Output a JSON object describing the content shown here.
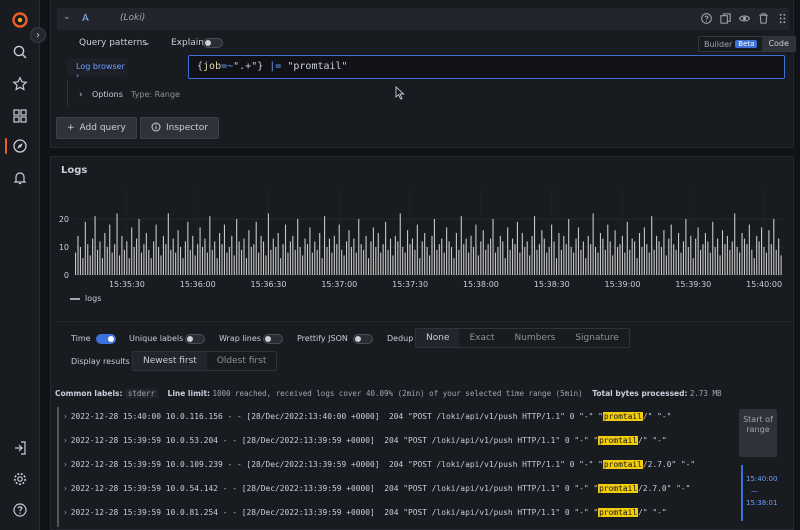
{
  "colors": {
    "accent": "#3d71d9",
    "brand": "#f05a28",
    "highlight": "#f2cc0c",
    "bars": "#c7c7c7"
  },
  "rail": {
    "icons": [
      "grafana-logo-icon",
      "search-icon",
      "star-icon",
      "dashboards-icon",
      "explore-icon",
      "alerting-bell-icon",
      "sign-in-icon",
      "gear-icon",
      "help-icon"
    ]
  },
  "query": {
    "letter": "A",
    "datasource": "(Loki)",
    "patterns_label": "Query patterns",
    "explain_label": "Explain",
    "builder_label": "Builder",
    "beta_badge": "Beta",
    "code_label": "Code",
    "log_browser_label": "Log browser",
    "expr": {
      "open": "{",
      "label": "job",
      "op": "=~",
      "value": "\".+\"",
      "close": "}",
      "pipe": " |= ",
      "filter": "\"promtail\""
    },
    "options_label": "Options",
    "options_type": "Type: Range"
  },
  "buttons": {
    "add_query": "Add query",
    "inspector": "Inspector"
  },
  "logs": {
    "title": "Logs",
    "legend": "logs",
    "controls": {
      "time": "Time",
      "unique_labels": "Unique labels",
      "wrap_lines": "Wrap lines",
      "prettify_json": "Prettify JSON",
      "dedup": "Dedup",
      "dedup_options": [
        "None",
        "Exact",
        "Numbers",
        "Signature"
      ],
      "display_results": "Display results",
      "order_options": [
        "Newest first",
        "Oldest first"
      ]
    },
    "meta": {
      "common_labels_key": "Common labels:",
      "common_labels_val": "stderr",
      "line_limit_key": "Line limit:",
      "line_limit_val": "1000 reached, received logs cover 40.09% (2min) of your selected time range (5min)",
      "bytes_key": "Total bytes processed:",
      "bytes_val": "2.73 MB"
    },
    "rows": [
      {
        "pre": "2022-12-28 15:40:00 10.0.116.156 - - [28/Dec/2022:13:40:00 +0000]  204 \"POST /loki/api/v1/push HTTP/1.1\" 0 \"-\" \"",
        "hl": "promtail",
        "post": "/\" \"-\""
      },
      {
        "pre": "2022-12-28 15:39:59 10.0.53.204 - - [28/Dec/2022:13:39:59 +0000]  204 \"POST /loki/api/v1/push HTTP/1.1\" 0 \"-\" \"",
        "hl": "promtail",
        "post": "/\" \"-\""
      },
      {
        "pre": "2022-12-28 15:39:59 10.0.109.239 - - [28/Dec/2022:13:39:59 +0000]  204 \"POST /loki/api/v1/push HTTP/1.1\" 0 \"-\" \"",
        "hl": "promtail",
        "post": "/2.7.0\" \"-\""
      },
      {
        "pre": "2022-12-28 15:39:59 10.0.54.142 - - [28/Dec/2022:13:39:59 +0000]  204 \"POST /loki/api/v1/push HTTP/1.1\" 0 \"-\" \"",
        "hl": "promtail",
        "post": "/2.7.0\" \"-\""
      },
      {
        "pre": "2022-12-28 15:39:59 10.0.81.254 - - [28/Dec/2022:13:39:59 +0000]  204 \"POST /loki/api/v1/push HTTP/1.1\" 0 \"-\" \"",
        "hl": "promtail",
        "post": "/\" \"-\""
      }
    ],
    "range": {
      "start_label": "Start of range",
      "end_time": "15:40:00",
      "dash": "—",
      "start_time": "15:38:01"
    }
  },
  "chart_data": {
    "type": "bar",
    "legend": [
      "logs"
    ],
    "yticks": [
      0,
      10,
      20
    ],
    "ylim": [
      0,
      30
    ],
    "xticks": [
      "15:35:30",
      "15:36:00",
      "15:36:30",
      "15:37:00",
      "15:37:30",
      "15:38:00",
      "15:38:30",
      "15:39:00",
      "15:39:30",
      "15:40:00"
    ],
    "x_start": "15:35:08",
    "x_end": "15:40:08",
    "values": [
      8,
      14,
      10,
      6,
      19,
      11,
      7,
      13,
      21,
      9,
      12,
      6,
      15,
      10,
      18,
      8,
      11,
      22,
      7,
      14,
      9,
      12,
      6,
      17,
      10,
      13,
      20,
      8,
      11,
      15,
      9,
      6,
      12,
      18,
      10,
      7,
      14,
      11,
      22,
      9,
      13,
      8,
      16,
      10,
      6,
      12,
      19,
      9,
      14,
      7,
      11,
      17,
      10,
      13,
      8,
      21,
      9,
      12,
      6,
      15,
      11,
      18,
      8,
      10,
      14,
      7,
      20,
      12,
      9,
      13,
      6,
      16,
      10,
      11,
      19,
      8,
      14,
      12,
      7,
      22,
      9,
      13,
      10,
      15,
      6,
      11,
      18,
      8,
      12,
      14,
      9,
      20,
      10,
      7,
      13,
      11,
      17,
      8,
      12,
      9,
      15,
      6,
      21,
      10,
      13,
      8,
      14,
      11,
      18,
      9,
      7,
      12,
      16,
      10,
      13,
      8,
      20,
      11,
      9,
      14,
      6,
      12,
      17,
      10,
      15,
      8,
      11,
      19,
      9,
      13,
      7,
      14,
      12,
      22,
      10,
      8,
      16,
      11,
      13,
      9,
      18,
      6,
      12,
      15,
      10,
      7,
      14,
      20,
      9,
      11,
      13,
      8,
      17,
      12,
      10,
      6,
      15,
      9,
      21,
      11,
      13,
      8,
      14,
      10,
      18,
      7,
      12,
      16,
      9,
      11,
      13,
      20,
      8,
      10,
      14,
      12,
      6,
      17,
      9,
      13,
      11,
      19,
      8,
      15,
      10,
      12,
      7,
      14,
      21,
      9,
      11,
      16,
      13,
      8,
      10,
      18,
      12,
      6,
      15,
      9,
      14,
      11,
      20,
      10,
      8,
      13,
      17,
      9,
      12,
      6,
      14,
      11,
      22,
      10,
      8,
      15,
      13,
      9,
      18,
      12,
      7,
      16,
      10,
      11,
      14,
      8,
      19,
      9,
      13,
      12,
      6,
      15,
      10,
      17,
      11,
      8,
      21,
      9,
      14,
      12,
      10,
      16,
      7,
      13,
      18,
      11,
      9,
      15,
      8,
      12,
      20,
      10,
      14,
      6,
      13,
      17,
      9,
      11,
      15,
      12,
      8,
      19,
      10,
      13,
      7,
      16,
      11,
      14,
      9,
      12,
      22,
      10,
      8,
      15,
      13,
      11,
      18,
      9,
      6,
      14,
      12,
      17,
      10,
      8,
      16,
      11,
      20,
      9,
      13,
      7
    ]
  }
}
